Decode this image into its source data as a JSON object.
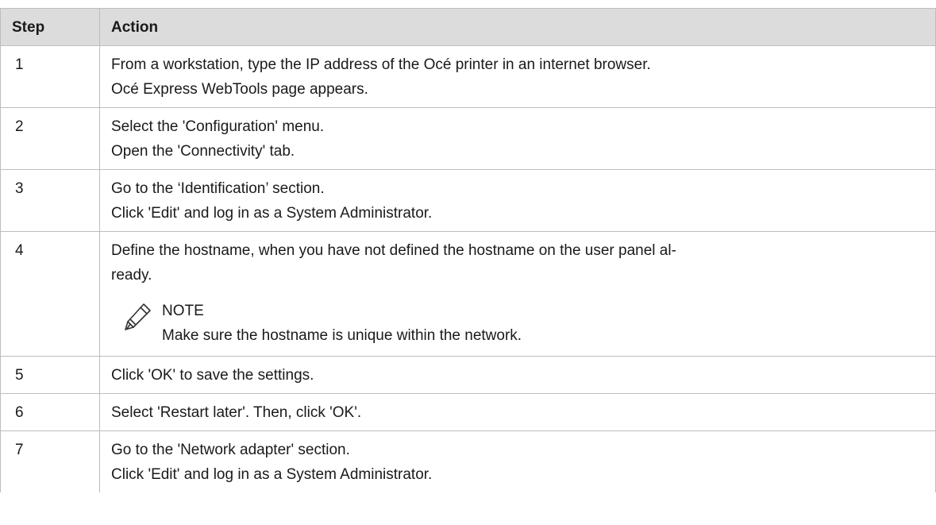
{
  "table": {
    "headers": {
      "step": "Step",
      "action": "Action"
    },
    "rows": [
      {
        "step": "1",
        "lines": [
          "From a workstation, type the IP address of the Océ printer in an internet browser.",
          "Océ Express WebTools page appears."
        ]
      },
      {
        "step": "2",
        "lines": [
          "Select the 'Configuration' menu.",
          "Open the 'Connectivity' tab."
        ]
      },
      {
        "step": "3",
        "lines": [
          "Go to the ‘Identification’ section.",
          "Click 'Edit' and log in as a System Administrator."
        ]
      },
      {
        "step": "4",
        "lines": [
          "Define the hostname, when you have not defined the hostname on the user panel al-",
          "ready."
        ],
        "note": {
          "icon": "pencil-note-icon",
          "title": "NOTE",
          "text": "Make sure the hostname is unique within the network."
        }
      },
      {
        "step": "5",
        "lines": [
          "Click 'OK' to save the settings."
        ]
      },
      {
        "step": "6",
        "lines": [
          "Select 'Restart later'. Then, click 'OK'."
        ]
      },
      {
        "step": "7",
        "lines": [
          "Go to the 'Network adapter' section.",
          "Click 'Edit' and log in as a System Administrator."
        ]
      }
    ]
  },
  "colors": {
    "header_bg": "#dcdcdc",
    "border": "#bdbdbd",
    "text": "#1a1a1a"
  }
}
